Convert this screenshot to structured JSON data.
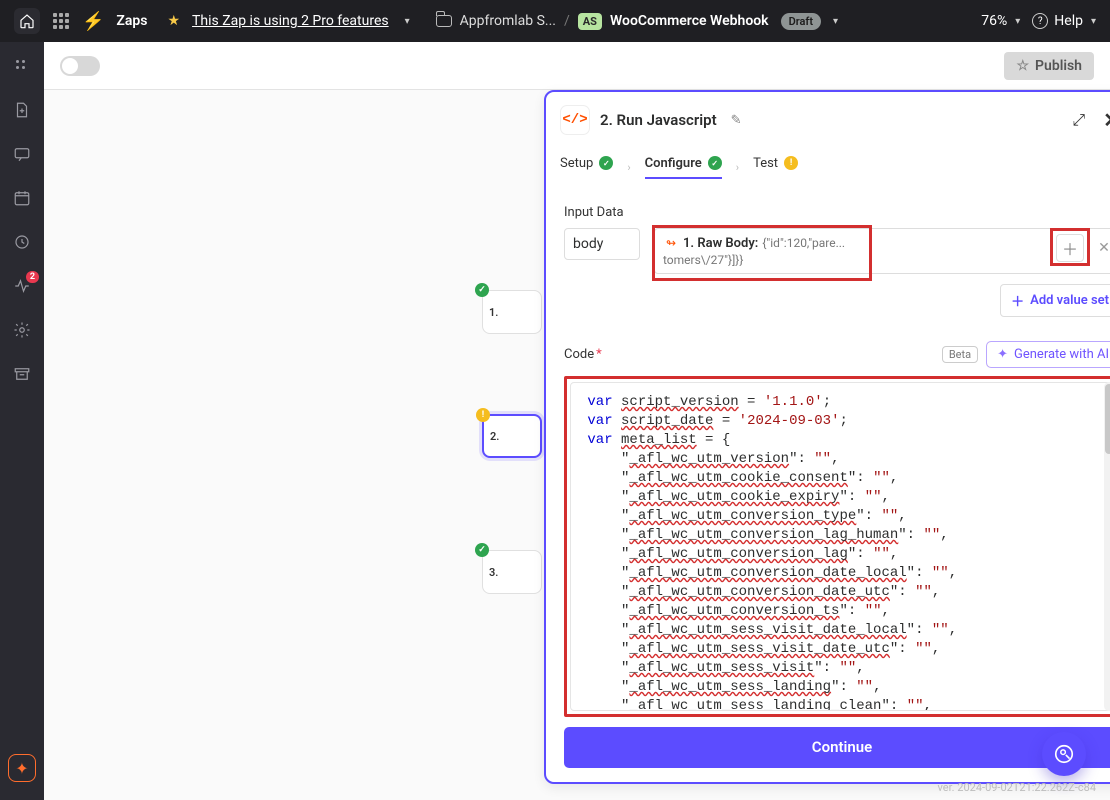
{
  "topbar": {
    "zaps": "Zaps",
    "pro_link": "This Zap is using 2 Pro features",
    "folder": "Appfromlab S...",
    "as_badge": "AS",
    "zap_title": "WooCommerce Webhook",
    "draft": "Draft",
    "zoom": "76%",
    "help": "Help"
  },
  "subbar": {
    "publish": "Publish"
  },
  "leftrail": {
    "badge": "2"
  },
  "mini_steps": {
    "s1": "1.",
    "s2": "2.",
    "s3": "3."
  },
  "panel": {
    "title": "2. Run Javascript",
    "steps": {
      "setup": "Setup",
      "configure": "Configure",
      "test": "Test"
    },
    "input_data_label": "Input Data",
    "body_value": "body",
    "raw_body_label": "1. Raw Body:",
    "raw_body_preview": "{\"id\":120,\"pare...",
    "raw_body_line2": "tomers\\/27\"}]}}",
    "add_value_set": "Add value set",
    "code_label": "Code",
    "beta": "Beta",
    "generate_ai": "Generate with AI",
    "continue": "Continue",
    "code": {
      "l1a": "script_version",
      "l1b": "'1.1.0'",
      "l2a": "script_date",
      "l2b": "'2024-09-03'",
      "l3a": "meta_list",
      "keys": [
        "_afl_wc_utm_version",
        "_afl_wc_utm_cookie_consent",
        "_afl_wc_utm_cookie_expiry",
        "_afl_wc_utm_conversion_type",
        "_afl_wc_utm_conversion_lag_human",
        "_afl_wc_utm_conversion_lag",
        "_afl_wc_utm_conversion_date_local",
        "_afl_wc_utm_conversion_date_utc",
        "_afl_wc_utm_conversion_ts",
        "_afl_wc_utm_sess_visit_date_local",
        "_afl_wc_utm_sess_visit_date_utc",
        "_afl_wc_utm_sess_visit",
        "_afl_wc_utm_sess_landing",
        "_afl_wc_utm_sess_landing_clean"
      ]
    }
  },
  "footer": {
    "version": "ver. 2024-09-02T21:22.262Z-c84"
  }
}
